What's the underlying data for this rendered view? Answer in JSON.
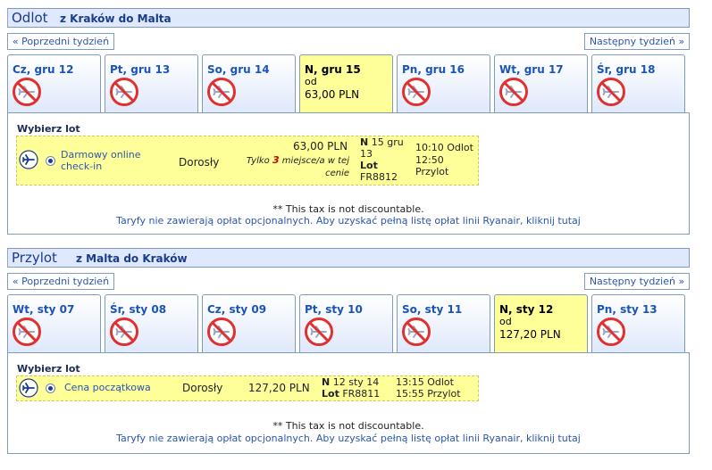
{
  "outbound": {
    "title": "Odlot",
    "route": "z Kraków do Malta",
    "prev_week": "« Poprzedni tydzień",
    "next_week": "Następny tydzień »",
    "days": [
      {
        "label": "Cz, gru 12",
        "available": false
      },
      {
        "label": "Pt, gru 13",
        "available": false
      },
      {
        "label": "So, gru 14",
        "available": false
      },
      {
        "label": "N, gru 15",
        "available": true,
        "from": "od",
        "price": "63,00 PLN"
      },
      {
        "label": "Pn, gru 16",
        "available": false
      },
      {
        "label": "Wt, gru 17",
        "available": false
      },
      {
        "label": "Śr, gru 18",
        "available": false
      }
    ],
    "choose_label": "Wybierz lot",
    "flight": {
      "fare_name": "Darmowy online check-in",
      "passenger": "Dorosły",
      "price": "63,00 PLN",
      "note_pre": "Tylko",
      "note_count": "3",
      "note_post": "miejsce/a w tej cenie",
      "date_day": "N",
      "date": "15 gru 13",
      "lot_label": "Lot",
      "flight_no": "FR8812",
      "dep_time": "10:10",
      "dep_label": "Odlot",
      "arr_time": "12:50",
      "arr_label": "Przylot"
    },
    "tax_note": "** This tax is not discountable.",
    "fees_note": "Taryfy nie zawierają opłat opcjonalnych. Aby uzyskać pełną listę opłat linii Ryanair, kliknij tutaj"
  },
  "inbound": {
    "title": "Przylot",
    "route": "z Malta do Kraków",
    "prev_week": "« Poprzedni tydzień",
    "next_week": "Następny tydzień »",
    "days": [
      {
        "label": "Wt, sty 07",
        "available": false
      },
      {
        "label": "Śr, sty 08",
        "available": false
      },
      {
        "label": "Cz, sty 09",
        "available": false
      },
      {
        "label": "Pt, sty 10",
        "available": false
      },
      {
        "label": "So, sty 11",
        "available": false
      },
      {
        "label": "N, sty 12",
        "available": true,
        "from": "od",
        "price": "127,20 PLN"
      },
      {
        "label": "Pn, sty 13",
        "available": false
      }
    ],
    "choose_label": "Wybierz lot",
    "flight": {
      "fare_name": "Cena początkowa",
      "passenger": "Dorosły",
      "price": "127,20 PLN",
      "date_day": "N",
      "date": "12 sty 14",
      "lot_label": "Lot",
      "flight_no": "FR8811",
      "dep_time": "13:15",
      "dep_label": "Odlot",
      "arr_time": "15:55",
      "arr_label": "Przylot"
    },
    "tax_note": "** This tax is not discountable.",
    "fees_note": "Taryfy nie zawierają opłat opcjonalnych. Aby uzyskać pełną listę opłat linii Ryanair, kliknij tutaj"
  },
  "icons": {
    "no_flight": "no-flight-icon",
    "plane": "plane-icon"
  },
  "colors": {
    "header_bg": "#dfe8fc",
    "selected_day": "#ffff99",
    "link": "#2a55b0",
    "highlight": "#cc0000"
  }
}
